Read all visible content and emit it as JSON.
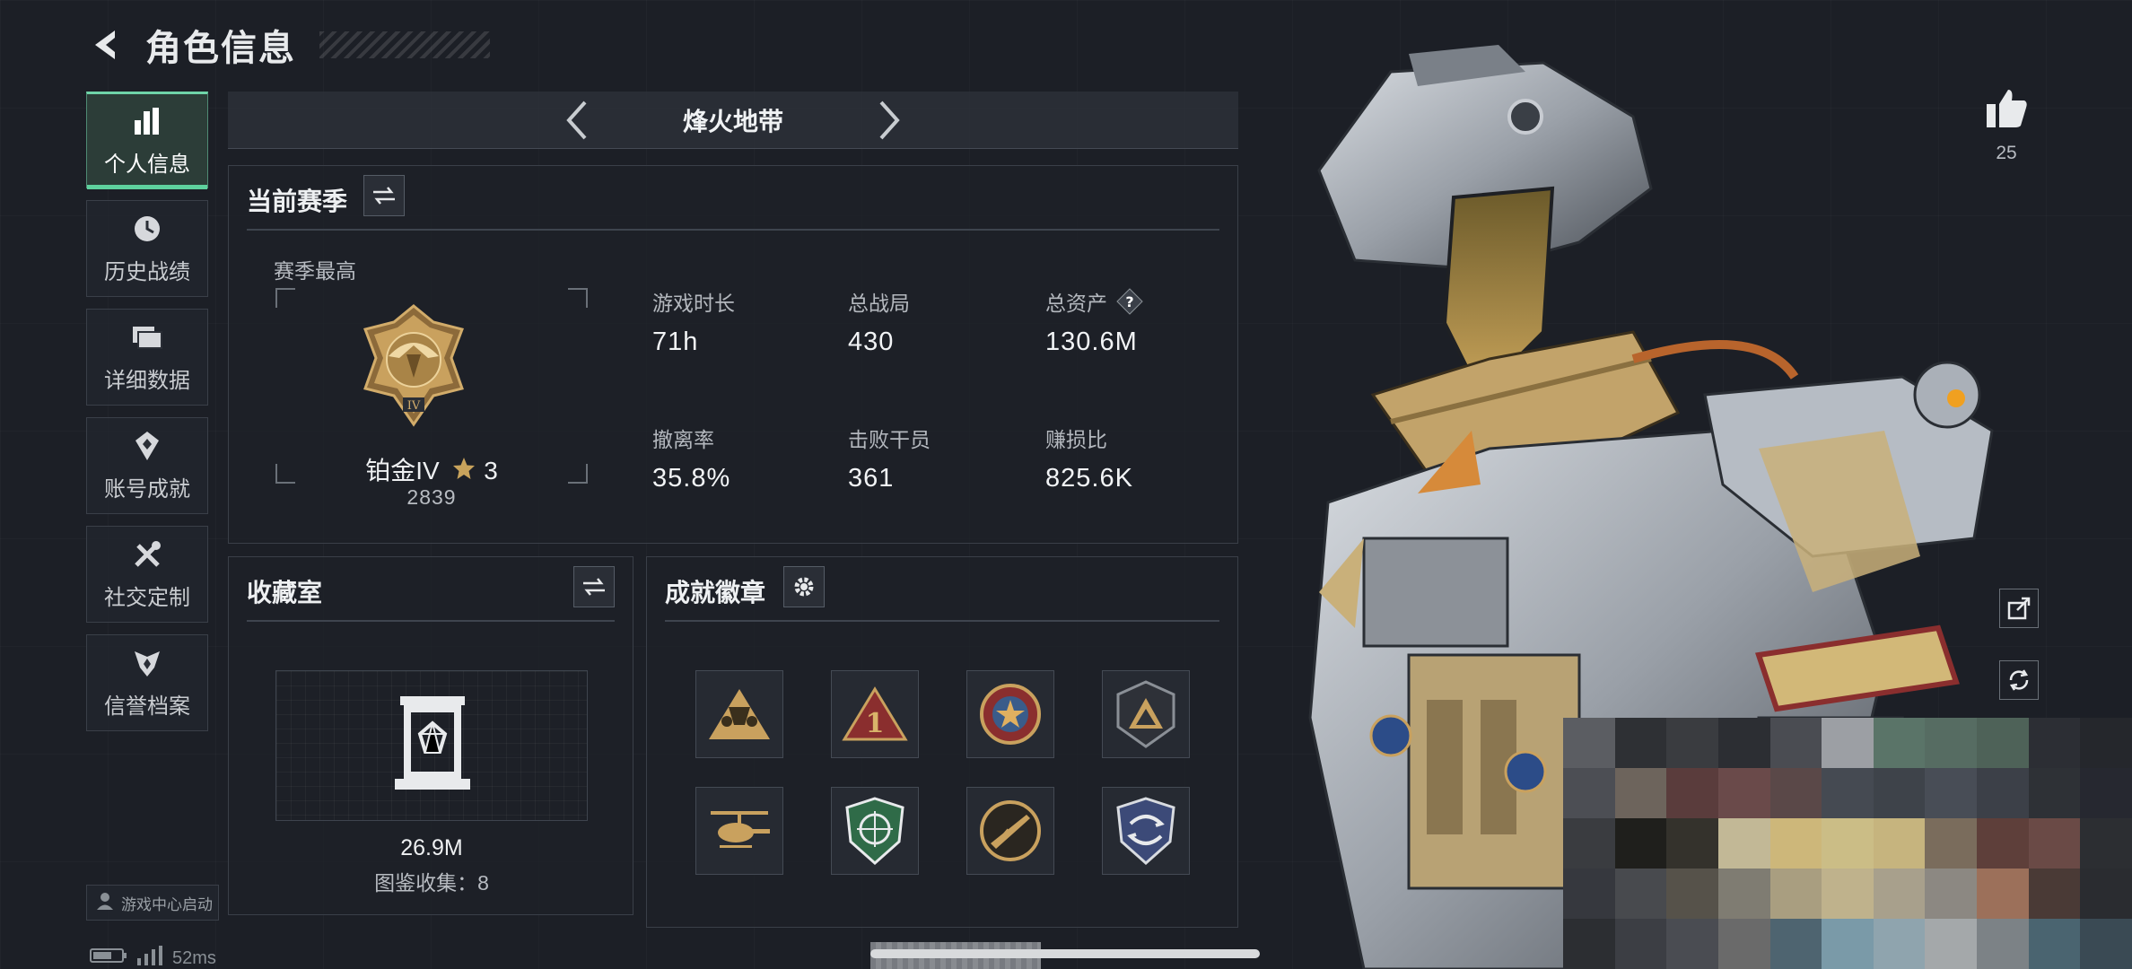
{
  "header": {
    "title": "角色信息"
  },
  "sidebar": {
    "items": [
      {
        "label": "个人信息",
        "icon": "bar-chart-icon",
        "active": true
      },
      {
        "label": "历史战绩",
        "icon": "clock-icon",
        "active": false
      },
      {
        "label": "详细数据",
        "icon": "folder-icon",
        "active": false
      },
      {
        "label": "账号成就",
        "icon": "medal-icon",
        "active": false
      },
      {
        "label": "社交定制",
        "icon": "tools-icon",
        "active": false
      },
      {
        "label": "信誉档案",
        "icon": "shield-badge-icon",
        "active": false
      }
    ],
    "game_center": "游戏中心启动"
  },
  "status": {
    "ping": "52ms"
  },
  "mode": {
    "title": "烽火地带"
  },
  "season": {
    "title": "当前赛季",
    "best_label": "赛季最高",
    "rank_name": "铂金IV",
    "rank_stars": "3",
    "rank_tier": "IV",
    "rank_score": "2839",
    "stats": [
      {
        "label": "游戏时长",
        "value": "71h"
      },
      {
        "label": "总战局",
        "value": "430"
      },
      {
        "label": "总资产",
        "value": "130.6M",
        "help": true
      },
      {
        "label": "撤离率",
        "value": "35.8%"
      },
      {
        "label": "击败干员",
        "value": "361"
      },
      {
        "label": "赚损比",
        "value": "825.6K"
      }
    ]
  },
  "collection": {
    "title": "收藏室",
    "value": "26.9M",
    "count_text": "图鉴收集：8"
  },
  "badges": {
    "title": "成就徽章",
    "items": [
      {
        "icon": "squad-triangle-badge-icon"
      },
      {
        "icon": "number-one-badge-icon"
      },
      {
        "icon": "star-emblem-badge-icon"
      },
      {
        "icon": "pyramid-badge-icon"
      },
      {
        "icon": "helicopter-badge-icon"
      },
      {
        "icon": "crosshair-shield-badge-icon"
      },
      {
        "icon": "rifle-badge-icon"
      },
      {
        "icon": "arrows-shield-badge-icon"
      }
    ]
  },
  "likes": {
    "count": "25"
  },
  "colors": {
    "accent": "#5ed19d",
    "gold": "#c8a35c",
    "background": "#1c1f26"
  }
}
